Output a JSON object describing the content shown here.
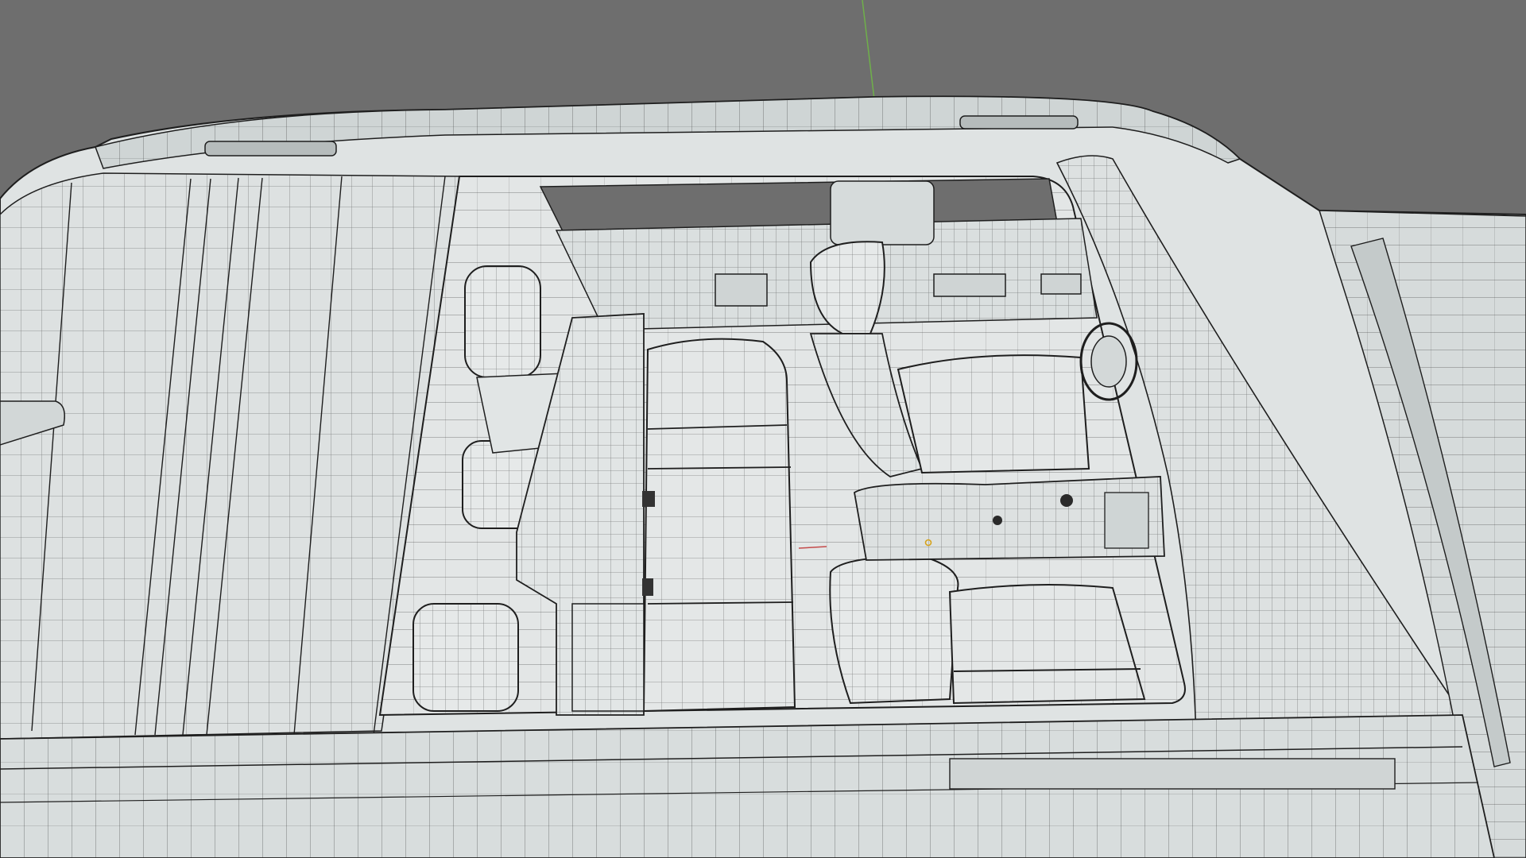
{
  "app": {
    "name": "",
    "view": "3d-viewport-wireframe"
  },
  "viewport": {
    "background_color": "#6e6e6e",
    "surface_color": "#dfe3e3",
    "surface_shade": "#c9cfcf",
    "wire_color": "#1e1e1e",
    "axis_y_color": "#6fb04a",
    "axis_x_color": "#c44a4a",
    "cursor_color": "#d6a21a",
    "overlay_text": ""
  },
  "scene": {
    "subject": "vehicle-cabin-wireframe-top-view",
    "icons": [
      "3d-cursor-icon",
      "y-axis-line",
      "x-axis-line"
    ]
  }
}
